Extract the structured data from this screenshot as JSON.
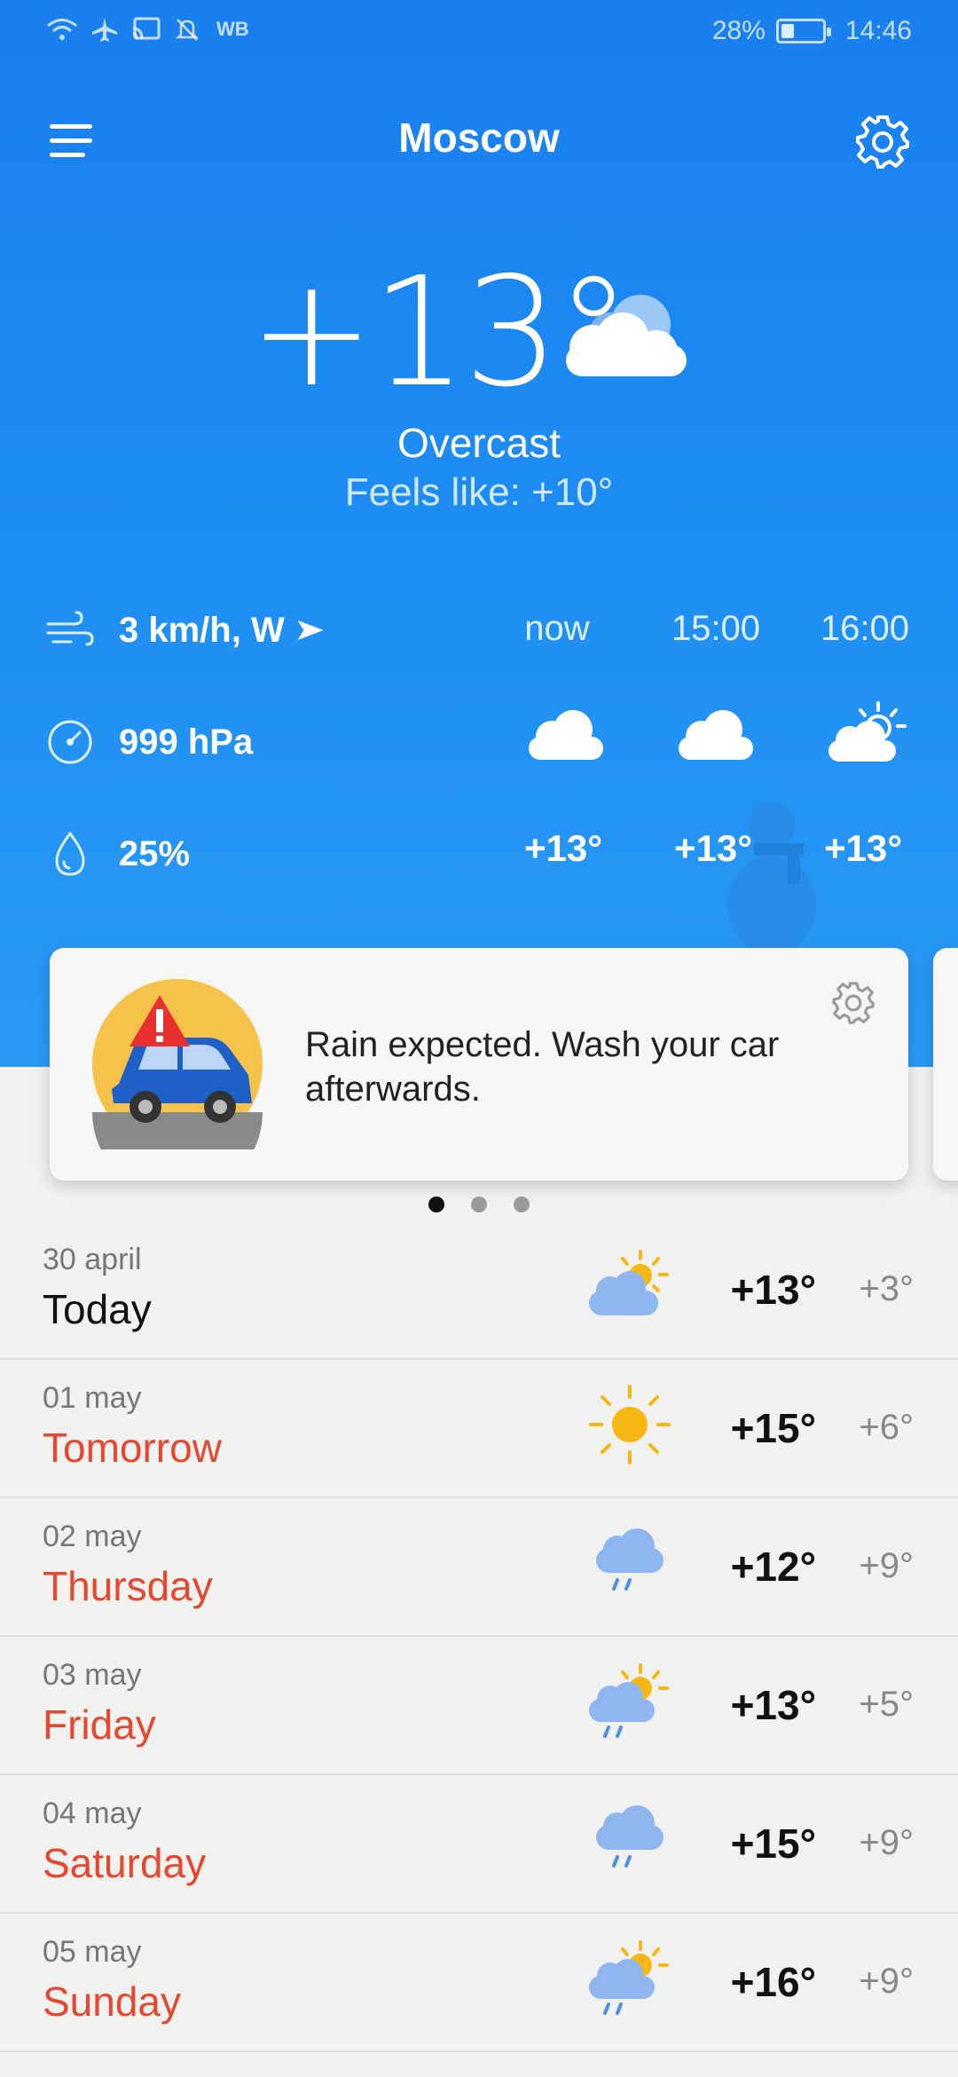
{
  "status_bar": {
    "network_label": "WB",
    "battery_percent": "28%",
    "time": "14:46"
  },
  "header": {
    "city": "Moscow"
  },
  "current": {
    "temperature": "+13°",
    "condition": "Overcast",
    "feels_like": "Feels like: +10°",
    "wind": "3 km/h, W",
    "pressure": "999 hPa",
    "humidity": "25%"
  },
  "hourly": [
    {
      "time": "now",
      "temp": "+13°",
      "icon": "cloud-icon"
    },
    {
      "time": "15:00",
      "temp": "+13°",
      "icon": "cloud-icon"
    },
    {
      "time": "16:00",
      "temp": "+13°",
      "icon": "partly-sunny-icon"
    }
  ],
  "alert_card": {
    "message": "Rain expected. Wash your car afterwards.",
    "page_count": 3,
    "active_page": 1
  },
  "daily": [
    {
      "date": "30 april",
      "day": "Today",
      "max": "+13°",
      "min": "+3°",
      "icon": "partly-cloudy-icon"
    },
    {
      "date": "01 may",
      "day": "Tomorrow",
      "max": "+15°",
      "min": "+6°",
      "icon": "sun-icon"
    },
    {
      "date": "02 may",
      "day": "Thursday",
      "max": "+12°",
      "min": "+9°",
      "icon": "rain-icon"
    },
    {
      "date": "03 may",
      "day": "Friday",
      "max": "+13°",
      "min": "+5°",
      "icon": "sun-rain-icon"
    },
    {
      "date": "04 may",
      "day": "Saturday",
      "max": "+15°",
      "min": "+9°",
      "icon": "rain-icon"
    },
    {
      "date": "05 may",
      "day": "Sunday",
      "max": "+16°",
      "min": "+9°",
      "icon": "sun-rain-icon"
    }
  ],
  "colors": {
    "sky_blue": "#1d8cf2",
    "weekend_red": "#e5482f",
    "sun_yellow": "#f6b614",
    "cloud_blue": "#8fb6ee"
  }
}
